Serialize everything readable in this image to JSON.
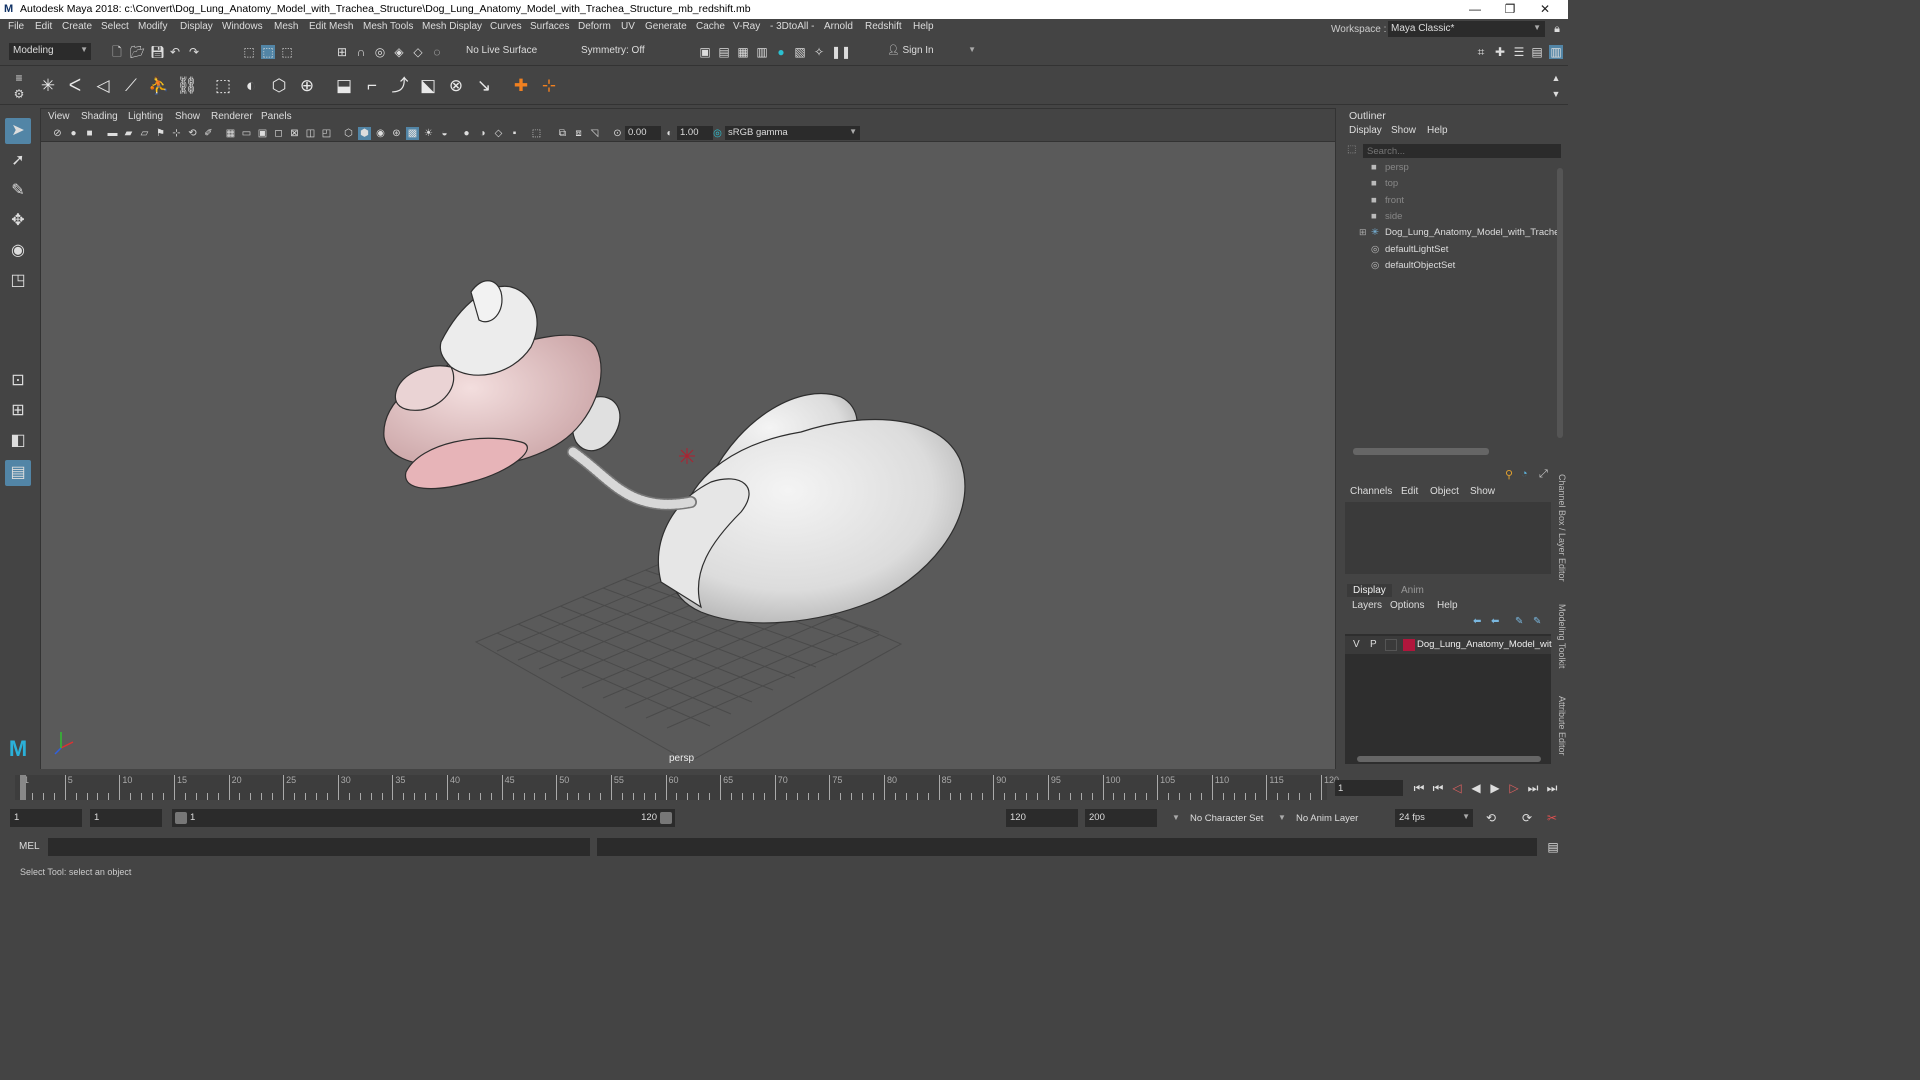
{
  "titlebar": {
    "title": "Autodesk Maya 2018: c:\\Convert\\Dog_Lung_Anatomy_Model_with_Trachea_Structure\\Dog_Lung_Anatomy_Model_with_Trachea_Structure_mb_redshift.mb",
    "logo": "M",
    "minimize": "—",
    "maximize": "❐",
    "close": "✕"
  },
  "menubar": {
    "items": [
      "File",
      "Edit",
      "Create",
      "Select",
      "Modify",
      "Display",
      "Windows",
      "Mesh",
      "Edit Mesh",
      "Mesh Tools",
      "Mesh Display",
      "Curves",
      "Surfaces",
      "Deform",
      "UV",
      "Generate",
      "Cache",
      "V-Ray",
      "- 3DtoAll -",
      "Arnold",
      "Redshift",
      "Help"
    ],
    "workspace_label": "Workspace :",
    "workspace_value": "Maya Classic*"
  },
  "statusline": {
    "mode": "Modeling",
    "live_surface": "No Live Surface",
    "symmetry": "Symmetry: Off",
    "sign_in": "Sign In"
  },
  "panel": {
    "menus": [
      "View",
      "Shading",
      "Lighting",
      "Show",
      "Renderer",
      "Panels"
    ],
    "exposure": "0.00",
    "gamma": "1.00",
    "color_space": "sRGB gamma",
    "camera": "persp"
  },
  "outliner": {
    "title": "Outliner",
    "menus": [
      "Display",
      "Show",
      "Help"
    ],
    "search_placeholder": "Search...",
    "items": [
      {
        "label": "persp",
        "icon": "camera-icon"
      },
      {
        "label": "top",
        "icon": "camera-icon"
      },
      {
        "label": "front",
        "icon": "camera-icon"
      },
      {
        "label": "side",
        "icon": "camera-icon"
      },
      {
        "label": "Dog_Lung_Anatomy_Model_with_Trache",
        "icon": "group-icon"
      },
      {
        "label": "defaultLightSet",
        "icon": "set-icon"
      },
      {
        "label": "defaultObjectSet",
        "icon": "set-icon"
      }
    ]
  },
  "channelbox": {
    "menus": [
      "Channels",
      "Edit",
      "Object",
      "Show"
    ]
  },
  "layereditor": {
    "tabs": [
      "Display",
      "Anim"
    ],
    "menus": [
      "Layers",
      "Options",
      "Help"
    ],
    "layer": {
      "v": "V",
      "p": "P",
      "name": "Dog_Lung_Anatomy_Model_wit",
      "color": "#b0163c"
    }
  },
  "sidetabs": [
    "Channel Box / Layer Editor",
    "Modeling Toolkit",
    "Attribute Editor"
  ],
  "timeline": {
    "ticks": [
      1,
      5,
      10,
      15,
      20,
      25,
      30,
      35,
      40,
      45,
      50,
      55,
      60,
      65,
      70,
      75,
      80,
      85,
      90,
      95,
      100,
      105,
      110,
      115,
      120
    ],
    "current_frame": "1"
  },
  "range": {
    "start": "1",
    "playback_start": "1",
    "slider_start": "1",
    "slider_end": "120",
    "playback_end": "120",
    "end": "200",
    "character_set": "No Character Set",
    "anim_layer": "No Anim Layer",
    "fps": "24 fps"
  },
  "cmdline": {
    "label": "MEL"
  },
  "helpline": {
    "text": "Select Tool: select an object"
  },
  "colors": {
    "accent": "#5285a6",
    "layer_color": "#b0163c",
    "viewport_bg": "#5a5a5a"
  }
}
